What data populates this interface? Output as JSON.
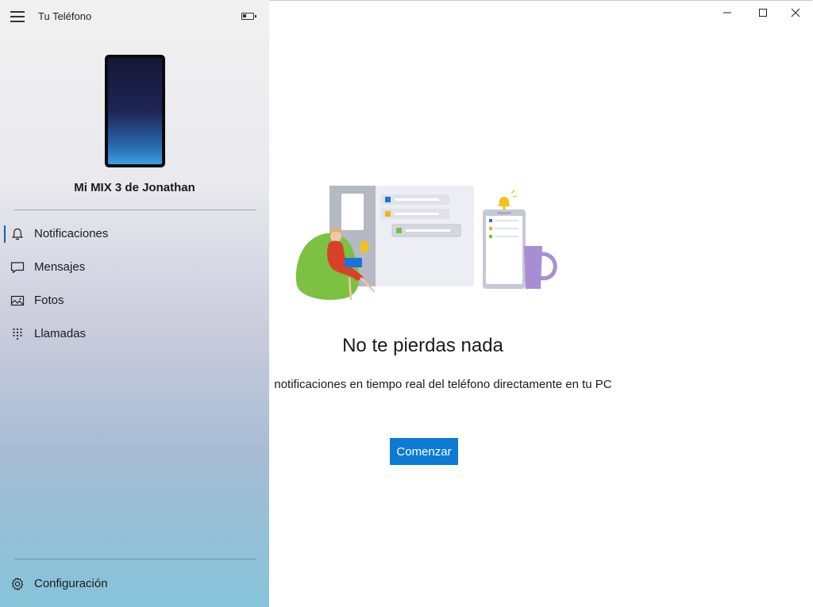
{
  "app": {
    "title": "Tu Teléfono"
  },
  "device": {
    "name": "Mi MIX 3 de Jonathan"
  },
  "nav": {
    "items": [
      {
        "label": "Notificaciones",
        "icon": "bell-icon",
        "active": true
      },
      {
        "label": "Mensajes",
        "icon": "message-icon",
        "active": false
      },
      {
        "label": "Fotos",
        "icon": "photos-icon",
        "active": false
      },
      {
        "label": "Llamadas",
        "icon": "dialpad-icon",
        "active": false
      }
    ],
    "settings": {
      "label": "Configuración",
      "icon": "gear-icon"
    }
  },
  "content": {
    "heading": "No te pierdas nada",
    "description": "notificaciones en tiempo real del teléfono directamente en tu PC",
    "button_label": "Comenzar"
  },
  "colors": {
    "accent": "#0078d7",
    "button": "#0b7bd3"
  }
}
